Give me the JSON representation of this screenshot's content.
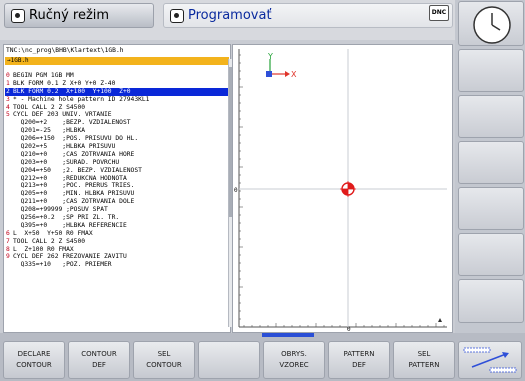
{
  "header": {
    "mode_manual": "Ručný režim",
    "mode_program": "Programovať",
    "dnc_badge": "DNC"
  },
  "program": {
    "path": "TNC:\\nc_prog\\BHB\\Klartext\\1GB.h",
    "file": "→1GB.h",
    "selected_line": 2,
    "lines": [
      {
        "n": "0",
        "code": "BEGIN PGM 1GB MM"
      },
      {
        "n": "1",
        "code": "BLK FORM 0.1 Z X+0 Y+0 Z-40"
      },
      {
        "n": "2",
        "code": "BLK FORM 0.2  X+100  Y+100  Z+0"
      },
      {
        "n": "3",
        "code": "* - Machine hole pattern ID 27943KL1"
      },
      {
        "n": "4",
        "code": "TOOL CALL 2 Z S4500"
      },
      {
        "n": "5",
        "code": "CYCL DEF 203 UNIV. VRTANIE"
      },
      {
        "n": "",
        "code": "  Q200=+2    ;BEZP. VZDIALENOST"
      },
      {
        "n": "",
        "code": "  Q201=-25   ;HLBKA"
      },
      {
        "n": "",
        "code": "  Q206=+150  ;POS. PRISUVU DO HL."
      },
      {
        "n": "",
        "code": "  Q202=+5    ;HLBKA PRISUVU"
      },
      {
        "n": "",
        "code": "  Q210=+0    ;CAS ZOTRVANIA HORE"
      },
      {
        "n": "",
        "code": "  Q203=+0    ;SURAD. POVRCHU"
      },
      {
        "n": "",
        "code": "  Q204=+50   ;2. BEZP. VZDIALENOST"
      },
      {
        "n": "",
        "code": "  Q212=+0    ;REDUKCNA HODNOTA"
      },
      {
        "n": "",
        "code": "  Q213=+0    ;POC. PRERUS TRIES."
      },
      {
        "n": "",
        "code": "  Q205=+0    ;MIN. HLBKA PRISUVU"
      },
      {
        "n": "",
        "code": "  Q211=+0    ;CAS ZOTRVANIA DOLE"
      },
      {
        "n": "",
        "code": "  Q208=+99999 ;POSUV SPAT"
      },
      {
        "n": "",
        "code": "  Q256=+0.2  ;SP PRI ZL. TR."
      },
      {
        "n": "",
        "code": "  Q395=+0    ;HLBKA REFERENCIE"
      },
      {
        "n": "6",
        "code": "L  X+50  Y+50 R0 FMAX"
      },
      {
        "n": "7",
        "code": "TOOL CALL 2 Z S4500"
      },
      {
        "n": "8",
        "code": "L  Z+100 R0 FMAX"
      },
      {
        "n": "9",
        "code": "CYCL DEF 262 FREZOVANIE ZAVITU"
      },
      {
        "n": "",
        "code": "  Q335=+10   ;POZ. PRIEMER"
      }
    ]
  },
  "graphics": {
    "axis_x": "X",
    "axis_y": "Y",
    "ruler_left_zero": "0",
    "ruler_bottom_zero": "0",
    "colors": {
      "x_axis": "#e0342a",
      "y_axis": "#26a33a",
      "z_axis": "#2e4fd8",
      "marker": "#e01b1b"
    }
  },
  "softkeys": [
    {
      "line1": "DECLARE",
      "line2": "CONTOUR"
    },
    {
      "line1": "CONTOUR",
      "line2": "DEF"
    },
    {
      "line1": "SEL",
      "line2": "CONTOUR"
    },
    {
      "line1": "",
      "line2": ""
    },
    {
      "line1": "OBRYS.",
      "line2": "VZOREC"
    },
    {
      "line1": "PATTERN",
      "line2": "DEF"
    },
    {
      "line1": "SEL",
      "line2": "PATTERN"
    }
  ],
  "accent": "#0a28d8"
}
